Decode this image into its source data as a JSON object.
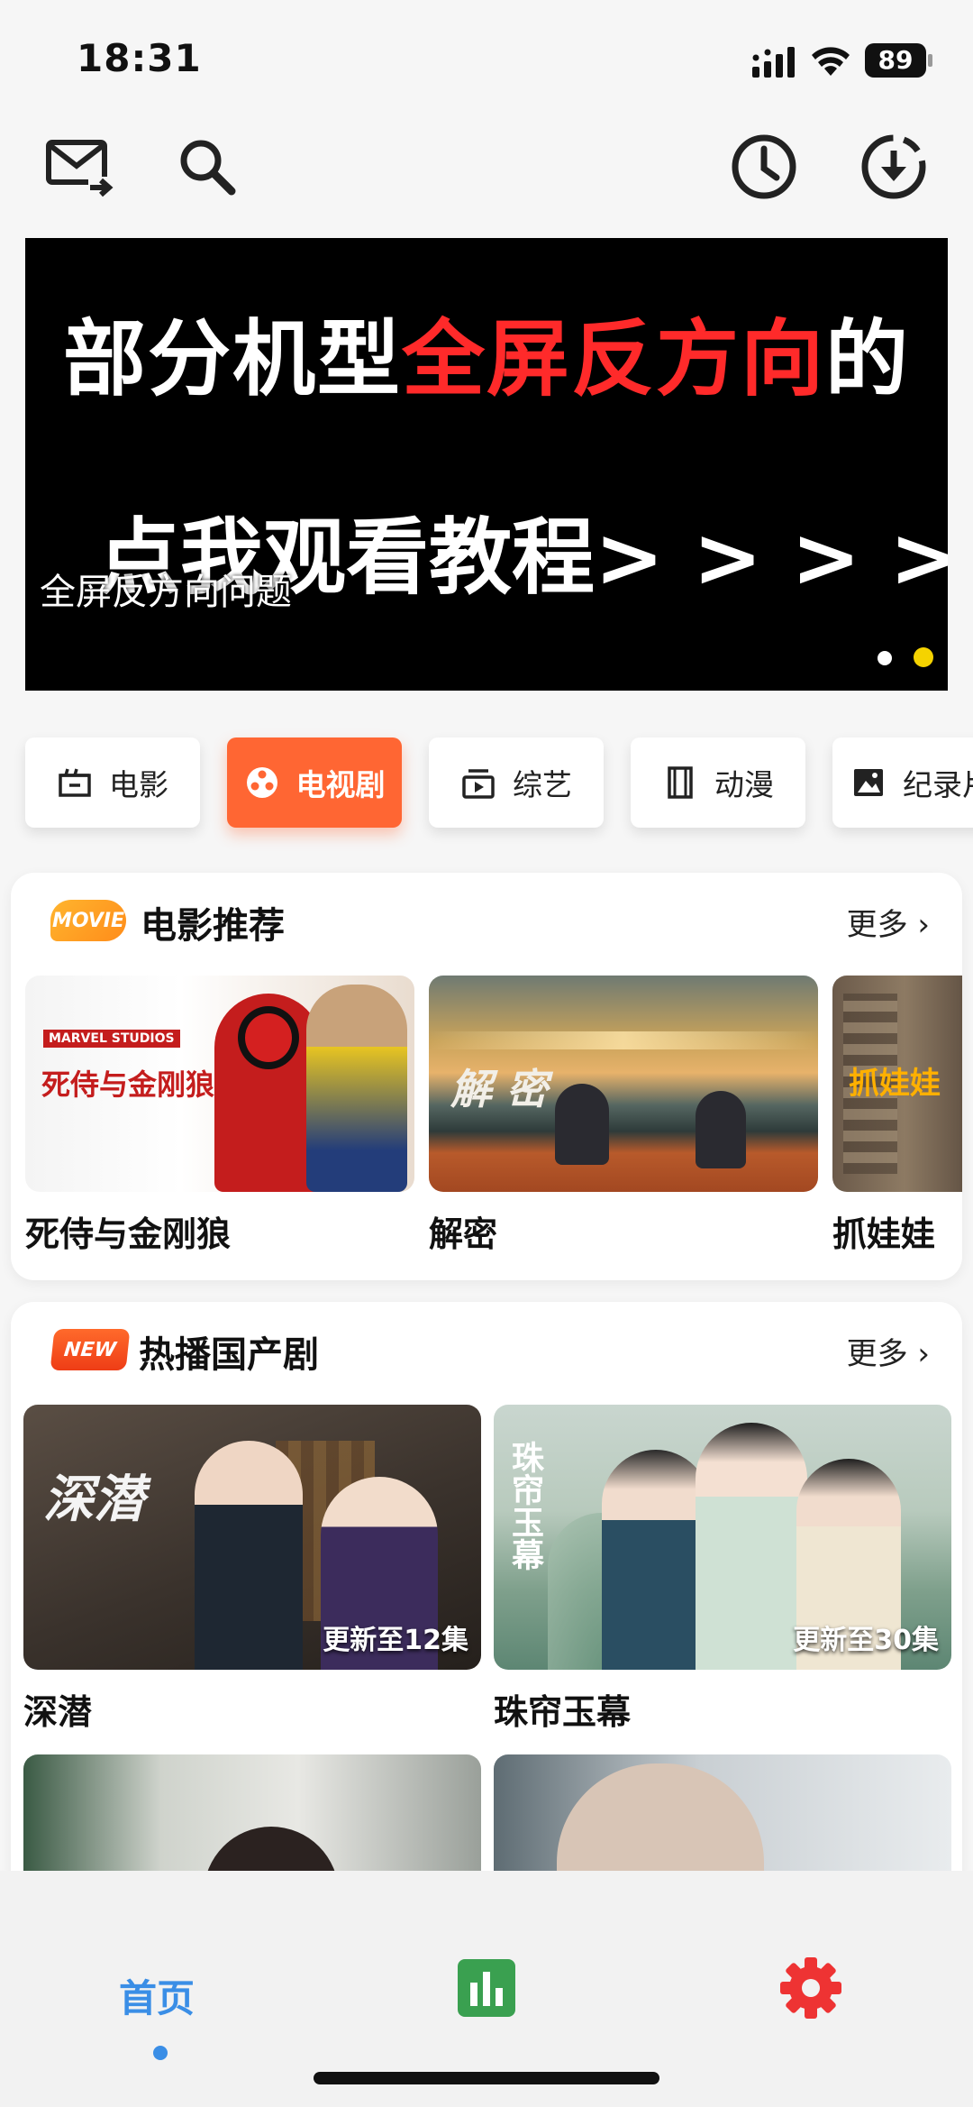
{
  "status": {
    "time": "18:31",
    "battery": "89"
  },
  "topbar": {
    "icons": [
      "mail-forward-icon",
      "search-icon",
      "history-clock-icon",
      "download-icon"
    ]
  },
  "banner": {
    "line1_prefix": "部分机型",
    "line1_highlight": "全屏反方向",
    "line1_suffix": "的",
    "line2": "点我观看教程> > > > >",
    "caption": "全屏反方向问题",
    "active_dot_color": "#f5d300"
  },
  "categories": [
    {
      "label": "电影",
      "icon": "film-clapper-icon",
      "active": false
    },
    {
      "label": "电视剧",
      "icon": "tv-reel-icon",
      "active": true
    },
    {
      "label": "综艺",
      "icon": "variety-show-icon",
      "active": false
    },
    {
      "label": "动漫",
      "icon": "animation-film-icon",
      "active": false
    },
    {
      "label": "纪录片",
      "icon": "documentary-image-icon",
      "active": false
    }
  ],
  "movies_section": {
    "badge": "MOVIE",
    "title": "电影推荐",
    "more": "更多",
    "items": [
      {
        "title": "死侍与金刚狼",
        "poster_text": "死侍与金刚狼"
      },
      {
        "title": "解密",
        "poster_text": "解 密"
      },
      {
        "title": "抓娃娃",
        "poster_text": "抓娃娃"
      }
    ]
  },
  "tv_section": {
    "badge": "NEW",
    "title": "热播国产剧",
    "more": "更多",
    "items": [
      {
        "title": "深潜",
        "poster_text": "深潜",
        "episodes": "更新至12集"
      },
      {
        "title": "珠帘玉幕",
        "poster_text": "珠帘玉幕",
        "episodes": "更新至30集"
      }
    ]
  },
  "bottom_nav": {
    "home_label": "首页",
    "accent_color": "#3a8ee6",
    "stats_color": "#3aa050",
    "settings_color": "#ee3333"
  }
}
